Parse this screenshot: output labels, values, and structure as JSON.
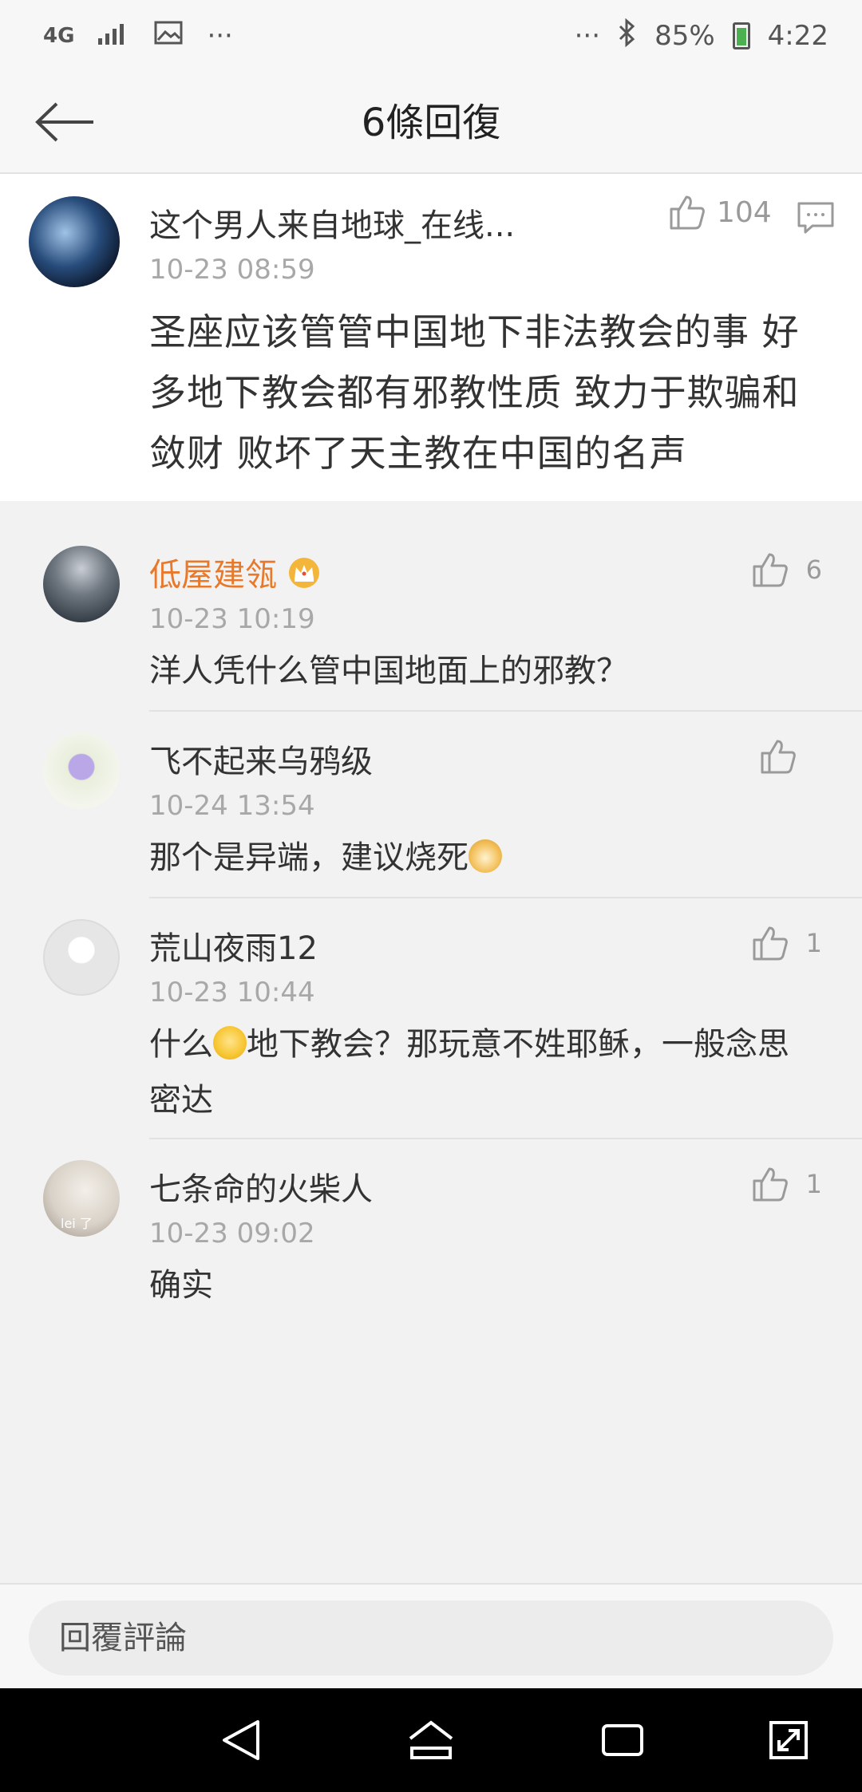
{
  "status_bar": {
    "network": "4G",
    "more_left": "···",
    "more_right": "···",
    "battery": "85%",
    "time": "4:22"
  },
  "header": {
    "title": "6條回復"
  },
  "main_comment": {
    "username": "这个男人来自地球_在线...",
    "timestamp": "10-23 08:59",
    "likes": "104",
    "text": "圣座应该管管中国地下非法教会的事  好多地下教会都有邪教性质   致力于欺骗和敛财  败坏了天主教在中国的名声"
  },
  "replies": [
    {
      "username": "低屋建瓴",
      "timestamp": "10-23 10:19",
      "likes": "6",
      "text": "洋人凭什么管中国地面上的邪教？",
      "vip": true
    },
    {
      "username": "飞不起来乌鸦级",
      "timestamp": "10-24 13:54",
      "likes": "",
      "text_before": "那个是异端，建议烧死",
      "text_after": ""
    },
    {
      "username": "荒山夜雨12",
      "timestamp": "10-23 10:44",
      "likes": "1",
      "text_before": "什么",
      "text_after": "地下教会？那玩意不姓耶稣，一般念思密达"
    },
    {
      "username": "七条命的火柴人",
      "timestamp": "10-23 09:02",
      "likes": "1",
      "text": "确实",
      "avatar_caption": "lei 了"
    }
  ],
  "reply_bar": {
    "placeholder": "回覆評論"
  },
  "colors": {
    "vip_name": "#e8792b",
    "muted": "#a8a8a8",
    "background": "#f2f2f2"
  }
}
